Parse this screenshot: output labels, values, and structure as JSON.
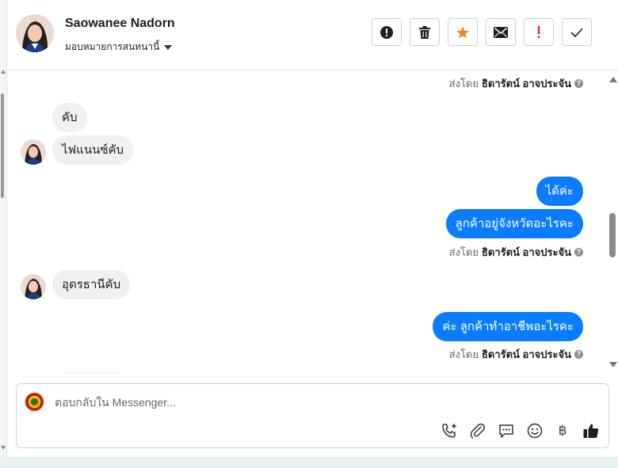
{
  "contact": {
    "name": "Saowanee Nadorn",
    "assign_label": "มอบหมายการสนทนานี้"
  },
  "toolbar": {
    "buttons": [
      {
        "name": "spam-button",
        "icon": "alert-circle-icon"
      },
      {
        "name": "delete-button",
        "icon": "trash-icon"
      },
      {
        "name": "star-button",
        "icon": "star-icon",
        "color": "#f5862a"
      },
      {
        "name": "mark-unread-button",
        "icon": "envelope-icon"
      },
      {
        "name": "important-button",
        "icon": "exclamation-icon",
        "color": "#e41e3f"
      },
      {
        "name": "done-button",
        "icon": "check-icon"
      }
    ]
  },
  "conversation": {
    "sent_by_prefix": "ส่งโดย",
    "agent_name": "ธิดารัตน์ อาจประจัน",
    "messages": [
      {
        "dir": "in",
        "text": "คับ"
      },
      {
        "dir": "in",
        "text": "ไฟแนนซ์คับ"
      },
      {
        "dir": "out",
        "text": "ได้ค่ะ"
      },
      {
        "dir": "out",
        "text": "ลูกค้าอยู่จังหวัดอะไรคะ"
      },
      {
        "dir": "in",
        "text": "อุดรธานีคับ"
      },
      {
        "dir": "out",
        "text": "ค่ะ ลูกค้าทำอาชีพอะไรคะ"
      }
    ]
  },
  "composer": {
    "placeholder": "ตอบกลับใน Messenger...",
    "icons": [
      "add-call-icon",
      "attachment-icon",
      "saved-reply-icon",
      "emoji-icon",
      "baht-icon",
      "thumbs-up-icon"
    ]
  },
  "colors": {
    "outgoing_bubble": "#0a7cff",
    "incoming_bubble": "#f0f0f0"
  }
}
